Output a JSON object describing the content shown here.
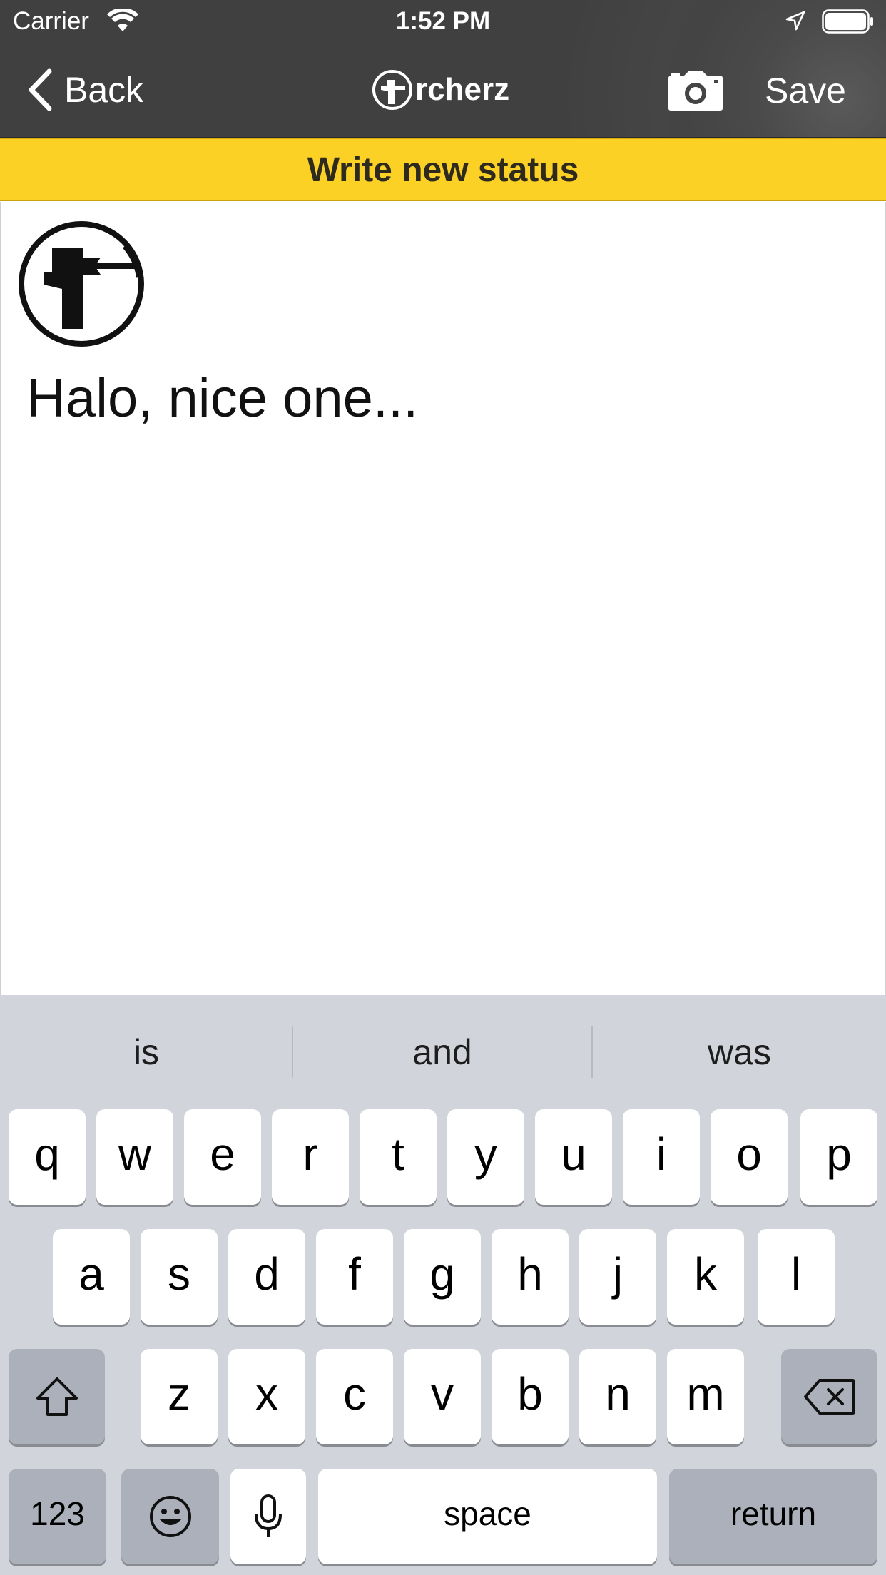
{
  "status_bar": {
    "carrier": "Carrier",
    "time": "1:52 PM"
  },
  "nav": {
    "back_label": "Back",
    "logo_text": "rcherz",
    "save_label": "Save"
  },
  "banner": {
    "title": "Write new status"
  },
  "editor": {
    "text": "Halo, nice one..."
  },
  "keyboard": {
    "suggestions": [
      "is",
      "and",
      "was"
    ],
    "row1": [
      "q",
      "w",
      "e",
      "r",
      "t",
      "y",
      "u",
      "i",
      "o",
      "p"
    ],
    "row2": [
      "a",
      "s",
      "d",
      "f",
      "g",
      "h",
      "j",
      "k",
      "l"
    ],
    "row3": [
      "z",
      "x",
      "c",
      "v",
      "b",
      "n",
      "m"
    ],
    "numbers_label": "123",
    "space_label": "space",
    "return_label": "return"
  },
  "colors": {
    "banner": "#fbd126",
    "nav_background": "#444444",
    "keyboard_background": "#d1d4db"
  }
}
